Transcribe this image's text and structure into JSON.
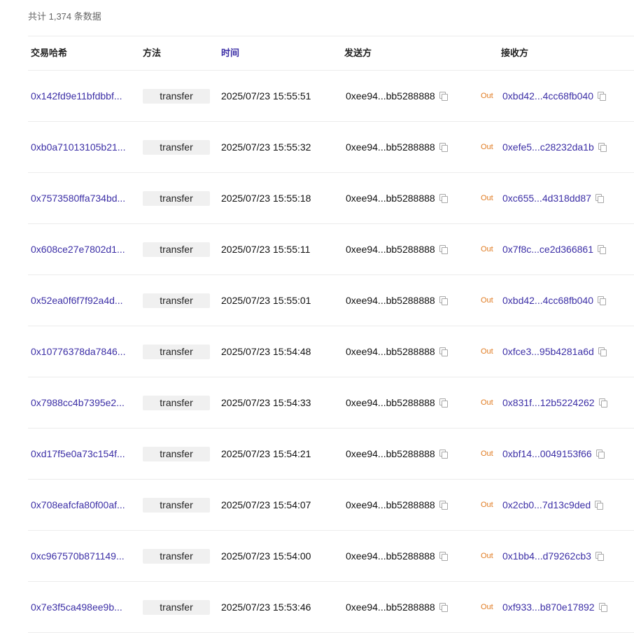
{
  "summary": {
    "total_text": "共计 1,374 条数据"
  },
  "table": {
    "headers": {
      "hash": "交易哈希",
      "method": "方法",
      "time": "时间",
      "from": "发送方",
      "to": "接收方"
    },
    "rows": [
      {
        "hash": "0x142fd9e11bfdbbf...",
        "method": "transfer",
        "time": "2025/07/23 15:55:51",
        "from": "0xee94...bb5288888",
        "direction": "Out",
        "to": "0xbd42...4cc68fb040"
      },
      {
        "hash": "0xb0a71013105b21...",
        "method": "transfer",
        "time": "2025/07/23 15:55:32",
        "from": "0xee94...bb5288888",
        "direction": "Out",
        "to": "0xefe5...c28232da1b"
      },
      {
        "hash": "0x7573580ffa734bd...",
        "method": "transfer",
        "time": "2025/07/23 15:55:18",
        "from": "0xee94...bb5288888",
        "direction": "Out",
        "to": "0xc655...4d318dd87"
      },
      {
        "hash": "0x608ce27e7802d1...",
        "method": "transfer",
        "time": "2025/07/23 15:55:11",
        "from": "0xee94...bb5288888",
        "direction": "Out",
        "to": "0x7f8c...ce2d366861"
      },
      {
        "hash": "0x52ea0f6f7f92a4d...",
        "method": "transfer",
        "time": "2025/07/23 15:55:01",
        "from": "0xee94...bb5288888",
        "direction": "Out",
        "to": "0xbd42...4cc68fb040"
      },
      {
        "hash": "0x10776378da7846...",
        "method": "transfer",
        "time": "2025/07/23 15:54:48",
        "from": "0xee94...bb5288888",
        "direction": "Out",
        "to": "0xfce3...95b4281a6d"
      },
      {
        "hash": "0x7988cc4b7395e2...",
        "method": "transfer",
        "time": "2025/07/23 15:54:33",
        "from": "0xee94...bb5288888",
        "direction": "Out",
        "to": "0x831f...12b5224262"
      },
      {
        "hash": "0xd17f5e0a73c154f...",
        "method": "transfer",
        "time": "2025/07/23 15:54:21",
        "from": "0xee94...bb5288888",
        "direction": "Out",
        "to": "0xbf14...0049153f66"
      },
      {
        "hash": "0x708eafcfa80f00af...",
        "method": "transfer",
        "time": "2025/07/23 15:54:07",
        "from": "0xee94...bb5288888",
        "direction": "Out",
        "to": "0x2cb0...7d13c9ded"
      },
      {
        "hash": "0xc967570b871149...",
        "method": "transfer",
        "time": "2025/07/23 15:54:00",
        "from": "0xee94...bb5288888",
        "direction": "Out",
        "to": "0x1bb4...d79262cb3"
      },
      {
        "hash": "0x7e3f5ca498ee9b...",
        "method": "transfer",
        "time": "2025/07/23 15:53:46",
        "from": "0xee94...bb5288888",
        "direction": "Out",
        "to": "0xf933...b870e17892"
      }
    ]
  },
  "icons": {
    "copy": "copy-icon"
  },
  "colors": {
    "link": "#3c2fa6",
    "direction_out": "#e07a1f",
    "method_badge_bg": "#f0f0f0",
    "divider": "#ececec"
  }
}
